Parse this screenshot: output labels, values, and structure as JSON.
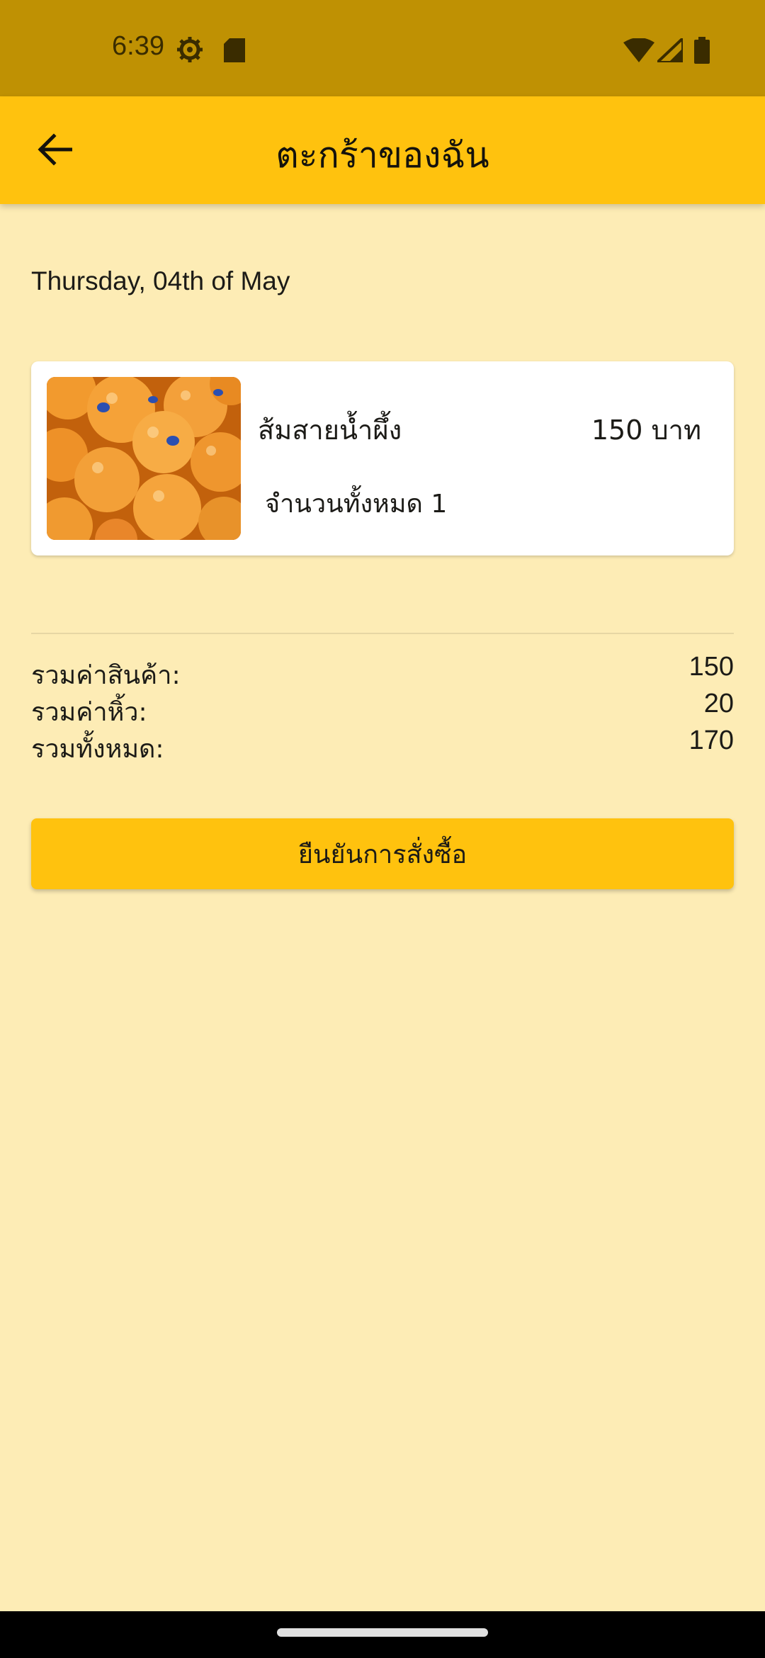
{
  "status_bar": {
    "time": "6:39",
    "icons": [
      "settings-gear-icon",
      "sd-card-icon",
      "wifi-icon",
      "cell-signal-icon",
      "battery-icon"
    ]
  },
  "app_bar": {
    "title": "ตะกร้าของฉัน",
    "back_icon": "arrow-back-icon",
    "background": "#FFC20E"
  },
  "order": {
    "date": "Thursday, 04th of May"
  },
  "cart": {
    "items": [
      {
        "name": "ส้มสายน้ำผึ้ง",
        "price": "150 บาท",
        "quantity": "จำนวนทั้งหมด 1",
        "image": "oranges-photo"
      }
    ]
  },
  "summary": {
    "subtotal_label": "รวมค่าสินค้า:",
    "subtotal_value": "150",
    "fee_label": "รวมค่าหิ้ว:",
    "fee_value": "20",
    "total_label": "รวมทั้งหมด:",
    "total_value": "170"
  },
  "actions": {
    "confirm_label": "ยืนยันการสั่งซื้อ"
  },
  "colors": {
    "page_background": "#FDECB5",
    "status_bar": "#BF9103",
    "accent": "#FFC20E"
  }
}
